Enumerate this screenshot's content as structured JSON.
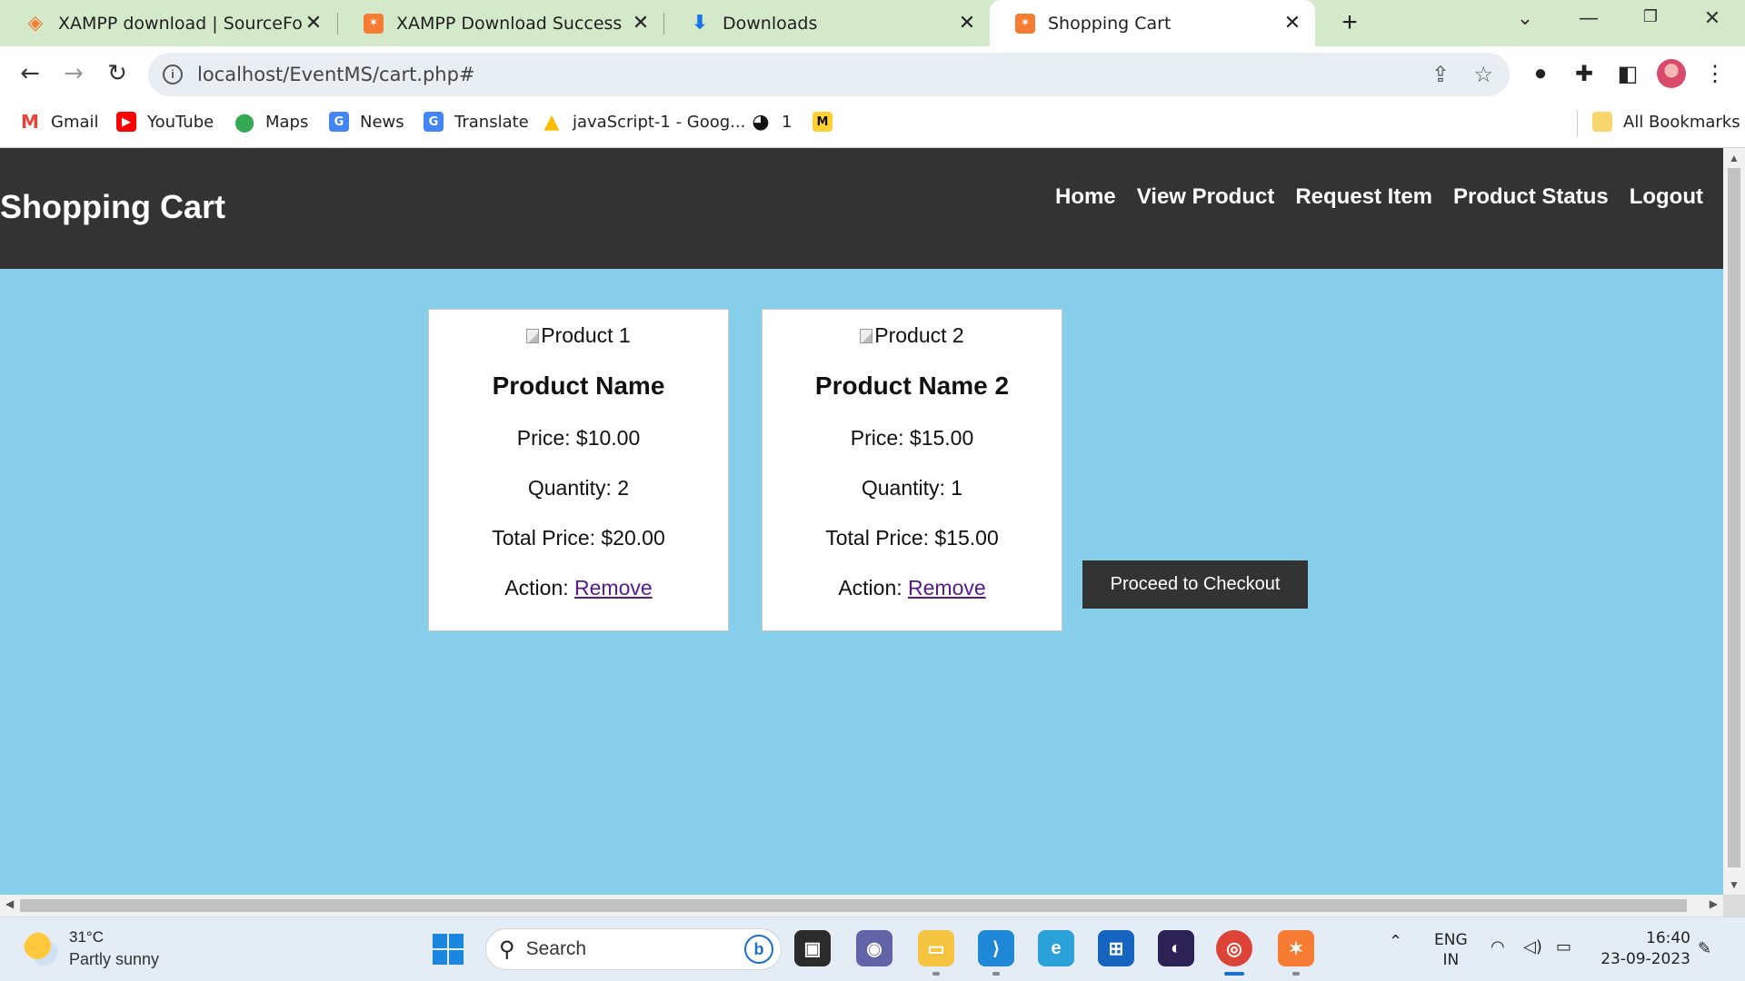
{
  "tabs": [
    {
      "title": "XAMPP download | SourceForge.",
      "icon": "sourceforge-icon"
    },
    {
      "title": "XAMPP Download Success",
      "icon": "xampp-icon"
    },
    {
      "title": "Downloads",
      "icon": "download-icon"
    },
    {
      "title": "Shopping Cart",
      "icon": "xampp-icon",
      "active": true
    }
  ],
  "address_bar": {
    "url": "localhost/EventMS/cart.php#"
  },
  "bookmarks": [
    {
      "label": "Gmail",
      "icon": "gmail-icon"
    },
    {
      "label": "YouTube",
      "icon": "youtube-icon"
    },
    {
      "label": "Maps",
      "icon": "maps-icon"
    },
    {
      "label": "News",
      "icon": "news-icon"
    },
    {
      "label": "Translate",
      "icon": "translate-icon"
    },
    {
      "label": "javaScript-1 - Goog...",
      "icon": "google-drive-icon"
    },
    {
      "label": "1",
      "icon": "globe-icon"
    },
    {
      "label": "",
      "icon": "miro-icon"
    },
    {
      "label": "All Bookmarks",
      "icon": "folder-icon"
    }
  ],
  "site": {
    "title": "Shopping Cart",
    "nav": [
      "Home",
      "View Product",
      "Request Item",
      "Product Status",
      "Logout"
    ]
  },
  "cart": {
    "items": [
      {
        "image_alt": "Product 1",
        "name": "Product Name",
        "price": "Price: $10.00",
        "quantity": "Quantity: 2",
        "total": "Total Price: $20.00",
        "action_label": "Action:",
        "action_link": "Remove"
      },
      {
        "image_alt": "Product 2",
        "name": "Product Name 2",
        "price": "Price: $15.00",
        "quantity": "Quantity: 1",
        "total": "Total Price: $15.00",
        "action_label": "Action:",
        "action_link": "Remove"
      }
    ],
    "checkout_label": "Proceed to Checkout"
  },
  "taskbar": {
    "weather_temp": "31°C",
    "weather_desc": "Partly sunny",
    "search_placeholder": "Search",
    "language_line1": "ENG",
    "language_line2": "IN",
    "time": "16:40",
    "date": "23-09-2023"
  },
  "colors": {
    "page_background": "#87ceeb",
    "header_background": "#333333",
    "tabstrip_background": "#d3e9c9",
    "link_visited": "#551a8b"
  }
}
